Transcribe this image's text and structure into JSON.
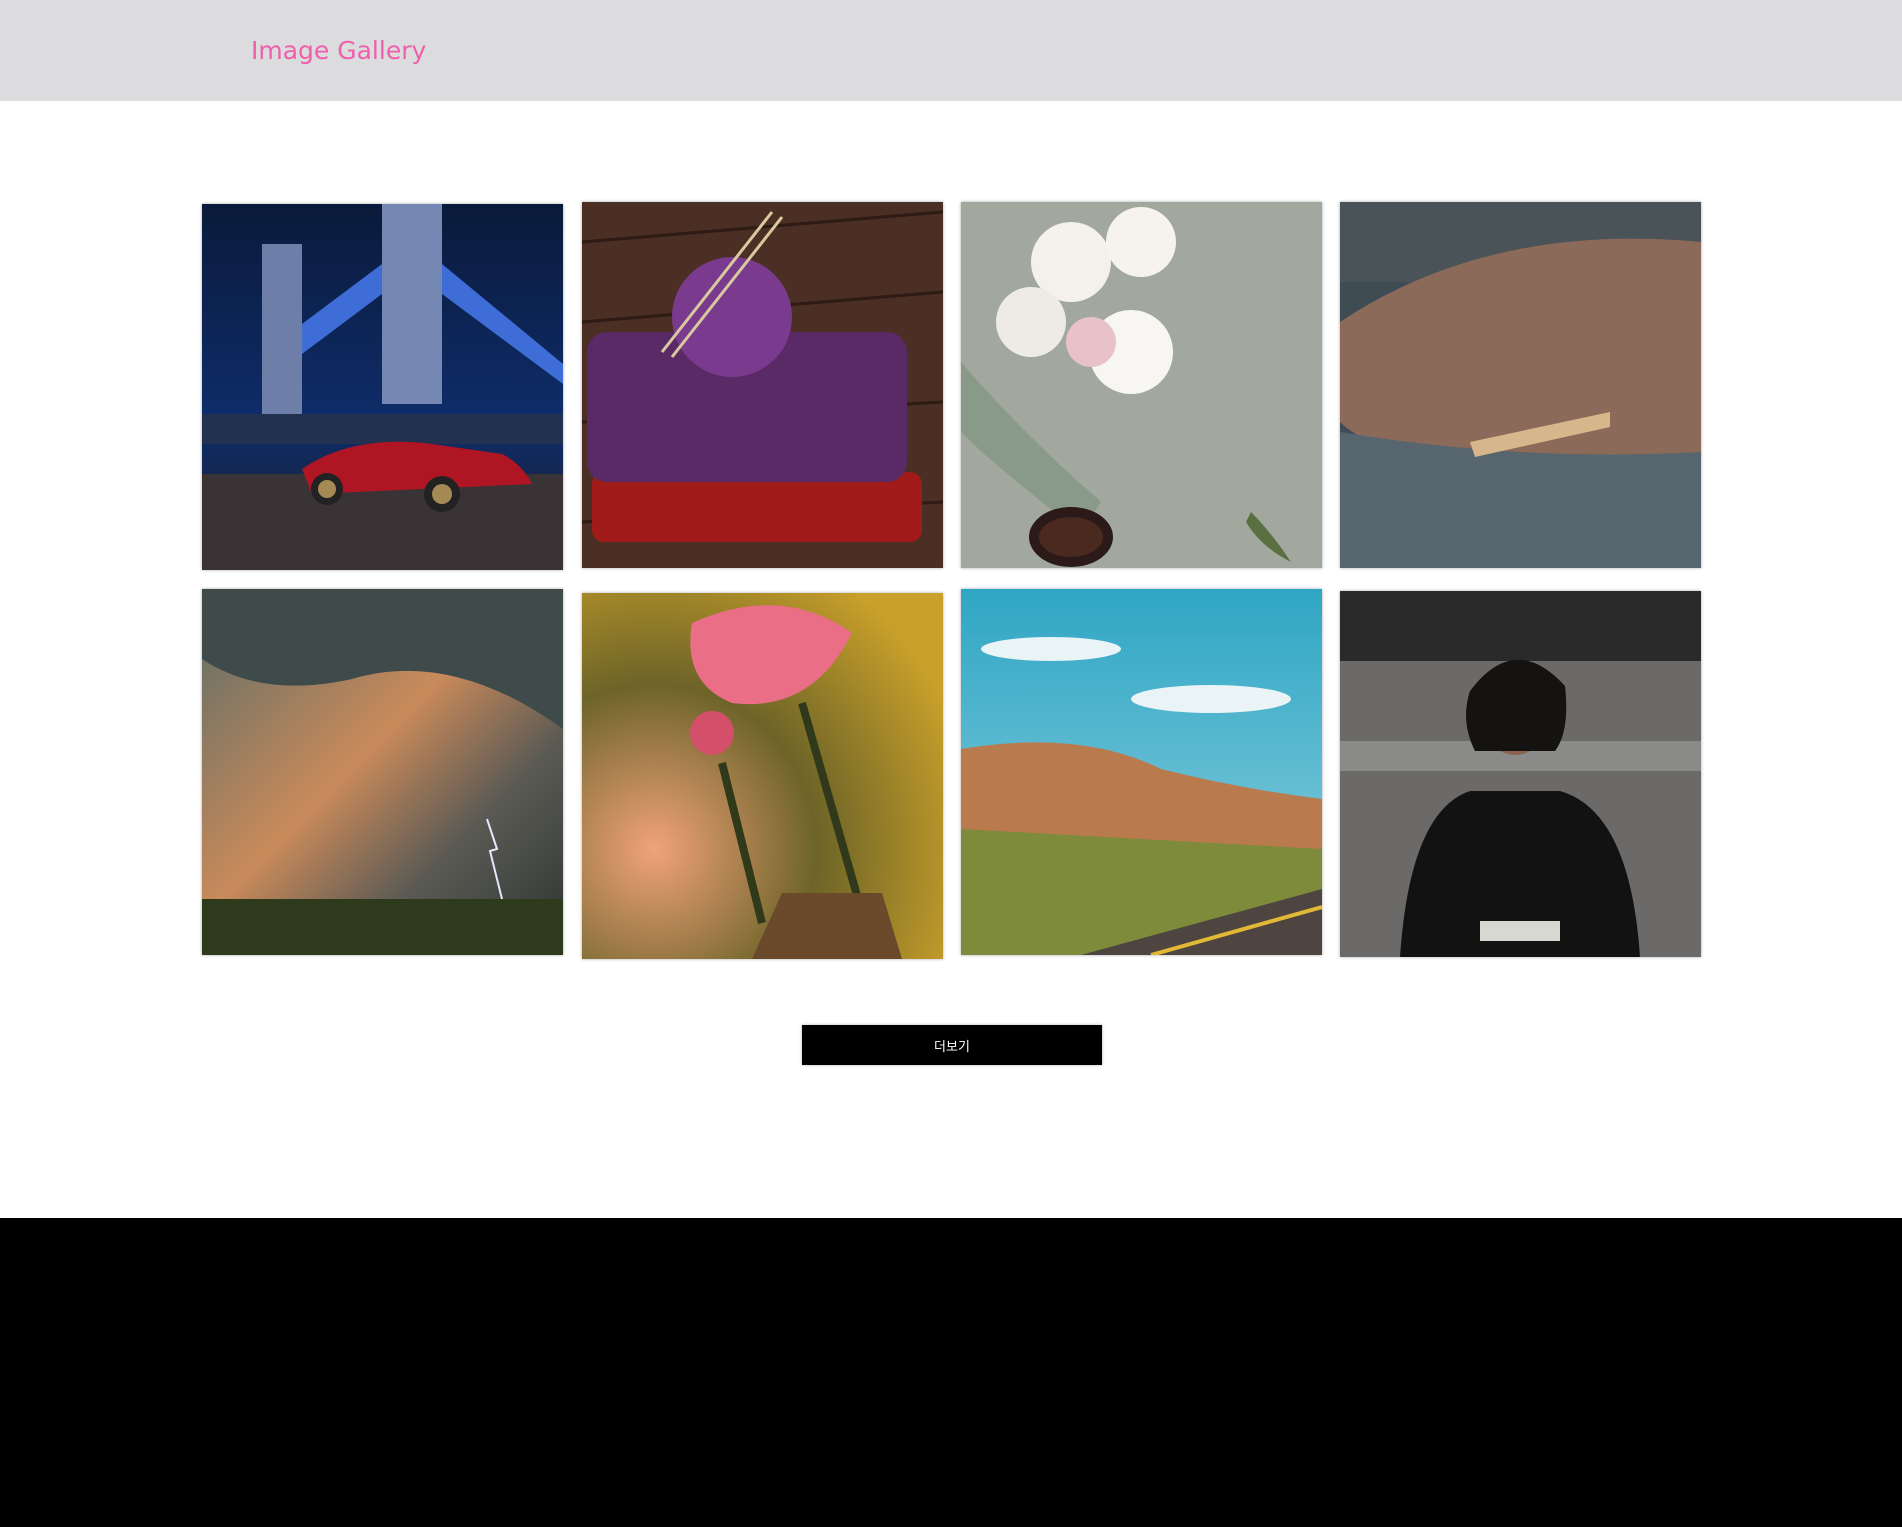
{
  "header": {
    "title": "Image Gallery"
  },
  "gallery": {
    "images": [
      {
        "subject": "bridge-car"
      },
      {
        "subject": "knitting-yarn"
      },
      {
        "subject": "flowers-coffee"
      },
      {
        "subject": "walrus"
      },
      {
        "subject": "storm-lightning"
      },
      {
        "subject": "pink-flowers"
      },
      {
        "subject": "desert-road"
      },
      {
        "subject": "portrait-woman"
      }
    ]
  },
  "load_more": {
    "label": "더보기"
  },
  "colors": {
    "header_bg": "#dcdcde",
    "brand": "#f05eac",
    "button_bg": "#000000",
    "footer_bg": "#000000"
  }
}
